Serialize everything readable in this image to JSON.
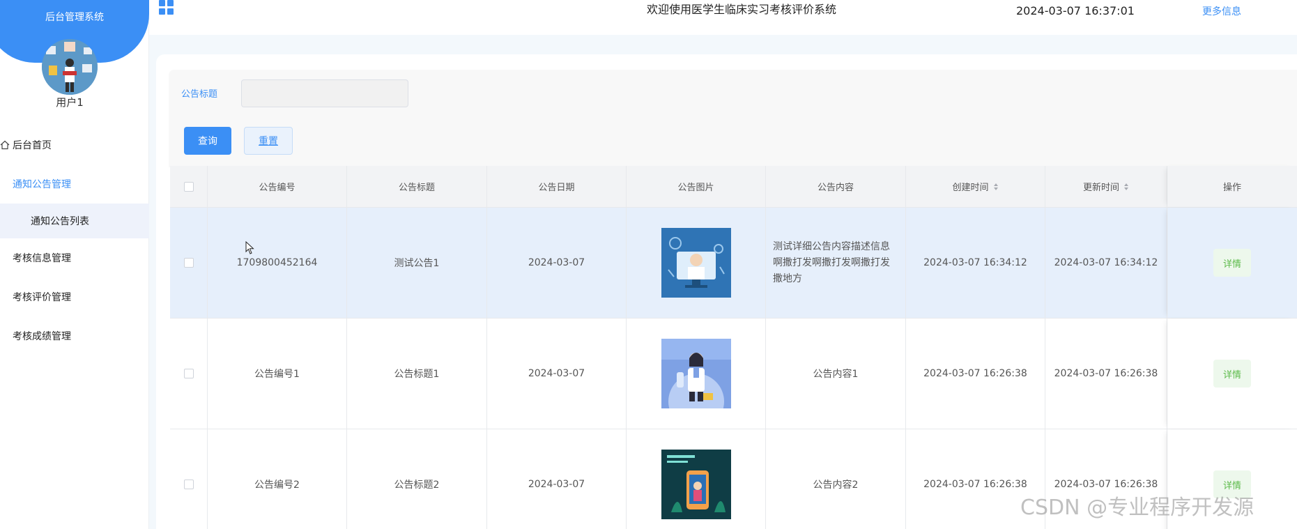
{
  "sidebar": {
    "brand_title": "后台管理系统",
    "username": "用户1",
    "menu": {
      "home": "后台首页",
      "notice_mgmt": "通知公告管理",
      "notice_list": "通知公告列表",
      "exam_info": "考核信息管理",
      "exam_eval": "考核评价管理",
      "exam_score": "考核成绩管理"
    }
  },
  "topbar": {
    "welcome": "欢迎使用医学生临床实习考核评价系统",
    "datetime": "2024-03-07 16:37:01",
    "more_info": "更多信息"
  },
  "search": {
    "label": "公告标题",
    "value": "",
    "query_button": "查询",
    "reset_button": "重置"
  },
  "table": {
    "headers": {
      "number": "公告编号",
      "title": "公告标题",
      "date": "公告日期",
      "image": "公告图片",
      "content": "公告内容",
      "created": "创建时间",
      "updated": "更新时间",
      "action": "操作"
    },
    "rows": [
      {
        "number": "1709800452164",
        "title": "测试公告1",
        "date": "2024-03-07",
        "image_icon": "doctor-screen-thumbnail",
        "content": "测试详细公告内容描述信息啊撒打发啊撒打发啊撒打发撒地方",
        "created": "2024-03-07 16:34:12",
        "updated": "2024-03-07 16:34:12",
        "action": "详情"
      },
      {
        "number": "公告编号1",
        "title": "公告标题1",
        "date": "2024-03-07",
        "image_icon": "female-doctor-thumbnail",
        "content": "公告内容1",
        "created": "2024-03-07 16:26:38",
        "updated": "2024-03-07 16:26:38",
        "action": "详情"
      },
      {
        "number": "公告编号2",
        "title": "公告标题2",
        "date": "2024-03-07",
        "image_icon": "phone-app-thumbnail",
        "content": "公告内容2",
        "created": "2024-03-07 16:26:38",
        "updated": "2024-03-07 16:26:38",
        "action": "详情"
      }
    ]
  },
  "watermark": "CSDN @专业程序开发源",
  "colors": {
    "primary": "#3b8ff5",
    "success_text": "#5cba4a",
    "row_hover": "#e6effb"
  }
}
